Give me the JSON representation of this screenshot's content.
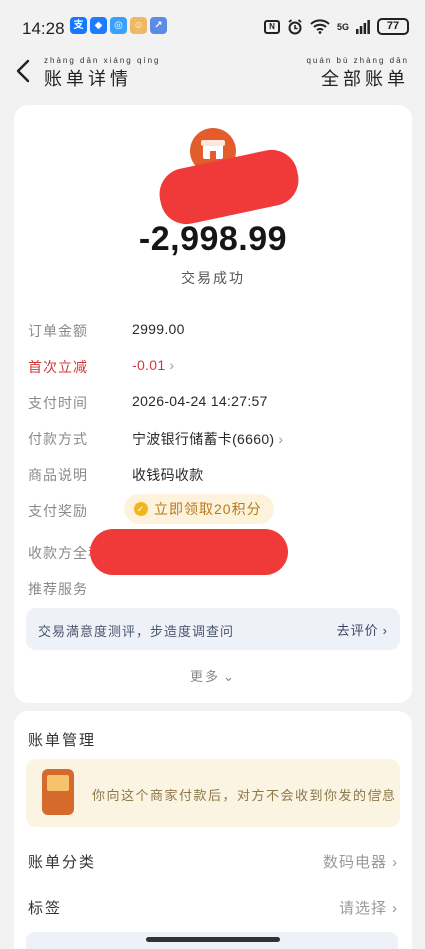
{
  "status_bar": {
    "time": "14:28",
    "apps": [
      {
        "icon": "alipay-icon",
        "color": "#1677ff",
        "glyph": "支"
      },
      {
        "icon": "app-blue-icon",
        "color": "#1e7bff",
        "glyph": "◆"
      },
      {
        "icon": "app-light-blue-icon",
        "color": "#3aa0ff",
        "glyph": "◎"
      },
      {
        "icon": "app-cartoon-icon",
        "color": "#f0b860",
        "glyph": "☺"
      },
      {
        "icon": "app-share-icon",
        "color": "#5a8be6",
        "glyph": "↗"
      }
    ],
    "nfc": "N",
    "signal_label": "5G",
    "battery": "77"
  },
  "nav": {
    "title_pinyin": "zhàng dān xiáng qíng",
    "title": "账单详情",
    "right_pinyin": "quán bù zhàng dān",
    "right_label": "全部账单"
  },
  "transaction": {
    "amount": "-2,998.99",
    "status": "交易成功",
    "merchant_color": "#e25d2b",
    "rows": [
      {
        "label": "订单金额",
        "value": "2999.00"
      },
      {
        "label": "首次立减",
        "value": "-0.01"
      },
      {
        "label": "支付时间",
        "value": "2026-04-24 14:27:57"
      },
      {
        "label": "付款方式",
        "value": "宁波银行储蓄卡(6660)"
      },
      {
        "label": "商品说明",
        "value": "收钱码收款"
      },
      {
        "label": "支付奖励",
        "value": "立即领取20积分"
      },
      {
        "label": "收款方全称",
        "value": ""
      },
      {
        "label": "推荐服务",
        "value": ""
      }
    ],
    "review_text": "交易満意度测评，步造度调查问",
    "review_link": "去评价",
    "more": "更多"
  },
  "bill_manage": {
    "title": "账单管理",
    "promo_text": "你向这个商家付款后，对方不会收到你发的信息",
    "rows": [
      {
        "label": "账单分类",
        "value": "数码电器"
      },
      {
        "label": "标签",
        "value": "请选择"
      }
    ]
  },
  "colors": {
    "accent_red": "#d23a3a",
    "redaction": "#f03a3a",
    "reward_bg": "#fdf2dc",
    "reward_text": "#b87a1c"
  }
}
